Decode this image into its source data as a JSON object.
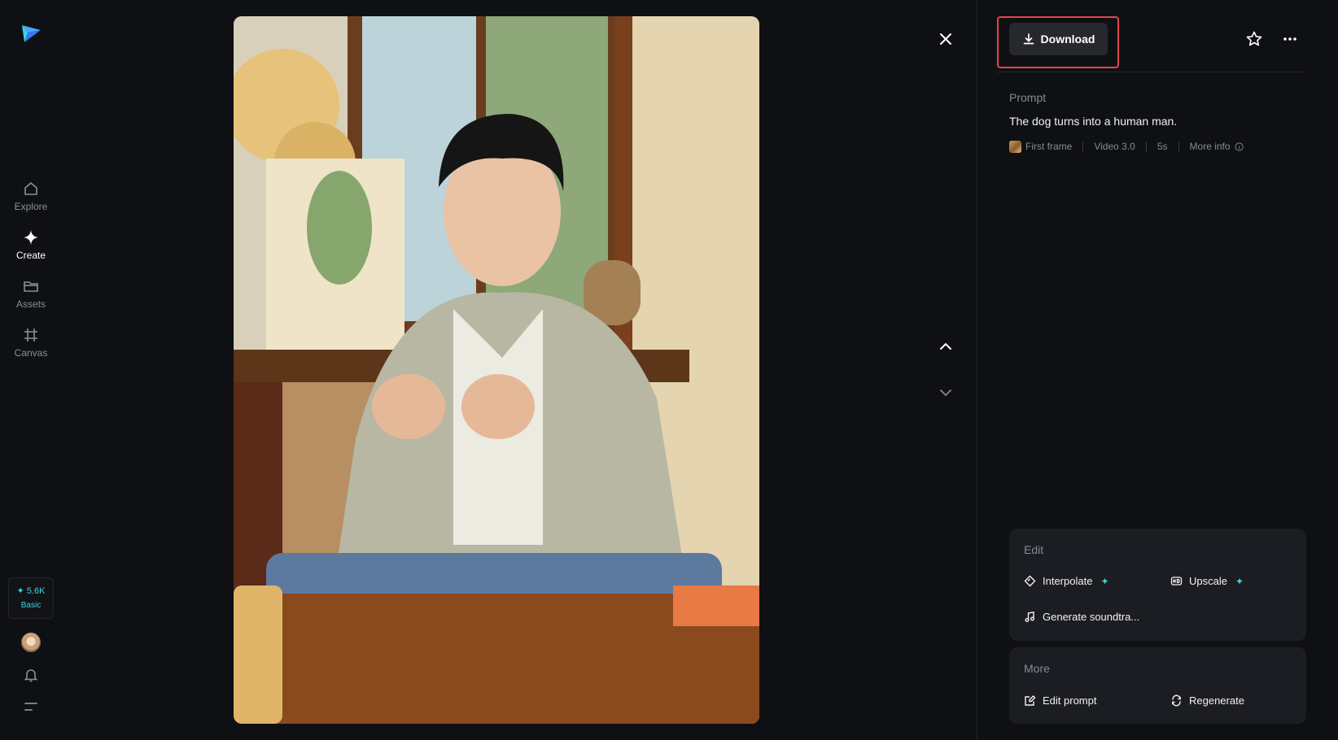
{
  "sidebar": {
    "logo_icon": "paper-plane-logo",
    "items": [
      {
        "label": "Explore",
        "icon": "home-icon",
        "active": false
      },
      {
        "label": "Create",
        "icon": "diamond-sparkle-icon",
        "active": true
      },
      {
        "label": "Assets",
        "icon": "folder-icon",
        "active": false
      },
      {
        "label": "Canvas",
        "icon": "hash-frame-icon",
        "active": false
      }
    ],
    "credits": {
      "amount": "✦ 5.6K",
      "plan": "Basic"
    },
    "accent_color": "#3ad7e0"
  },
  "viewer": {
    "close_icon": "close-icon",
    "prev_icon": "chevron-up-icon",
    "next_icon": "chevron-down-icon"
  },
  "panel": {
    "download_label": "Download",
    "highlight_color": "#e1454c",
    "prompt_label": "Prompt",
    "prompt_text": "The dog turns into a human man.",
    "meta": {
      "source": "First frame",
      "model": "Video 3.0",
      "duration": "5s",
      "more_info": "More info"
    },
    "edit": {
      "title": "Edit",
      "interpolate": "Interpolate",
      "upscale": "Upscale",
      "soundtrack": "Generate soundtra..."
    },
    "more": {
      "title": "More",
      "edit_prompt": "Edit prompt",
      "regenerate": "Regenerate"
    }
  }
}
